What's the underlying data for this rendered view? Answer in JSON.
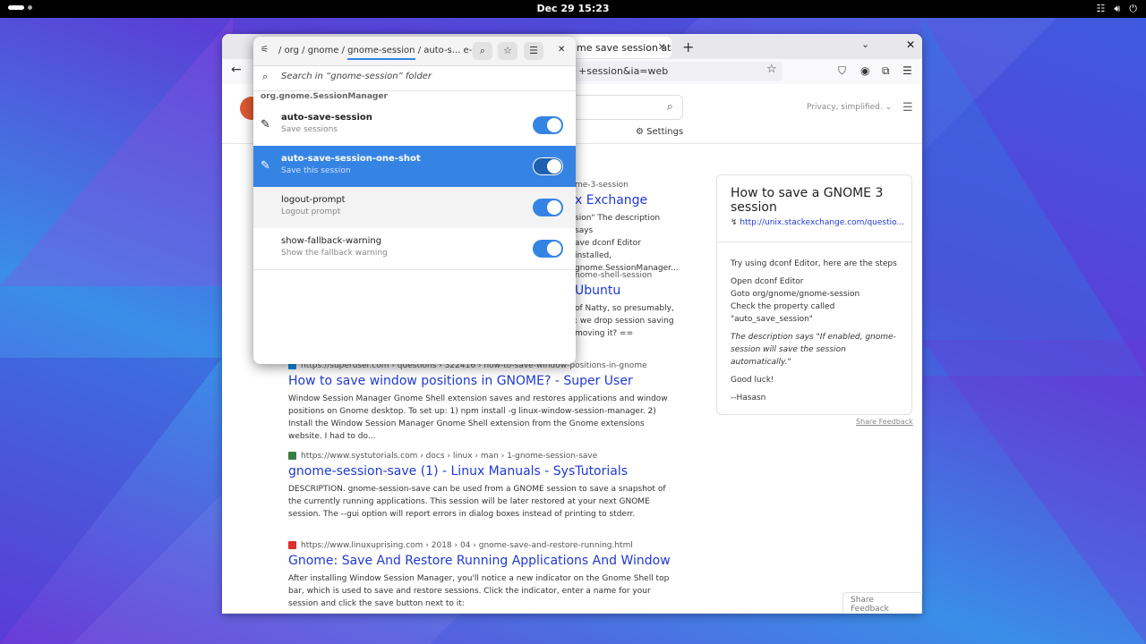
{
  "topbar": {
    "clock": "Dec 29  15:23",
    "tray_icons": [
      "network-icon",
      "volume-icon",
      "power-icon"
    ]
  },
  "browser": {
    "tab_title": "me save session at Du",
    "url_text": "+session&ia=web",
    "privacy_label": "Privacy, simplified.",
    "settings_label": "Settings",
    "results": [
      {
        "url": "",
        "title": "",
        "snippet": ""
      },
      {
        "url": "https://superuser.com › questions › 322416 › how-to-save-window-positions-in-gnome",
        "title": "How to save window positions in GNOME? - Super User",
        "snippet": "Window Session Manager Gnome Shell extension saves and restores applications and window positions on Gnome desktop. To set up: 1) npm install -g linux-window-session-manager. 2) Install the Window Session Manager Gnome Shell extension from the Gnome extensions website. I had to do..."
      },
      {
        "url": "https://www.systutorials.com › docs › linux › man › 1-gnome-session-save",
        "title": "gnome-session-save (1) - Linux Manuals - SysTutorials",
        "snippet": "DESCRIPTION. gnome-session-save can be used from a GNOME session to save a snapshot of the currently running applications. This session will be later restored at your next GNOME session. The --gui option will report errors in dialog boxes instead of printing to stderr."
      },
      {
        "url": "https://www.linuxuprising.com › 2018 › 04 › gnome-save-and-restore-running.html",
        "title": "Gnome: Save And Restore Running Applications And Window Positio...",
        "snippet": "After installing Window Session Manager, you'll notice a new indicator on the Gnome Shell top bar, which is used to save and restore sessions. Click the indicator, enter a name for your session and click the save button next to it:"
      }
    ],
    "partial_results": {
      "r1_url": "me-3-session",
      "r1_title": "x Exchange",
      "r1_snip": [
        "sion\" The description says",
        "ave dconf Editor installed,",
        "gnome.SessionManager..."
      ],
      "r2_url": "nome-shell-session",
      "r2_title": "Ubuntu",
      "r2_snip": [
        "of Natty, so presumably,",
        ": we drop session saving",
        "moving it? =="
      ]
    },
    "knowledge_panel": {
      "title": "How to save a GNOME 3 session",
      "link": "http://unix.stackexchange.com/questio...",
      "p1": "Try using dconf Editor, here are the steps",
      "p2_l1": "Open dconf Editor",
      "p2_l2": "Goto org/gnome/gnome-session",
      "p2_l3": "Check the property called",
      "p2_l4": "\"auto_save_session\"",
      "p3": "The description says \"If enabled, gnome-session will save the session automatically.\"",
      "p4": "Good luck!",
      "p5": "--Hasasn",
      "feedback": "Share Feedback"
    },
    "share_feedback_button": "Share Feedback"
  },
  "dconf": {
    "path": {
      "root": "/",
      "org": "org",
      "gnome": "gnome",
      "gnome_session": "gnome-session",
      "sep": "/",
      "trunc": "auto-s...",
      "trail": "e-shot"
    },
    "search_placeholder": "Search in “gnome-session” folder",
    "schema": "org.gnome.SessionManager",
    "keys": [
      {
        "name": "auto-save-session",
        "desc": "Save sessions",
        "value": true
      },
      {
        "name": "auto-save-session-one-shot",
        "desc": "Save this session",
        "value": true
      },
      {
        "name": "logout-prompt",
        "desc": "Logout prompt",
        "value": true
      },
      {
        "name": "show-fallback-warning",
        "desc": "Show the fallback warning",
        "value": true
      }
    ]
  }
}
